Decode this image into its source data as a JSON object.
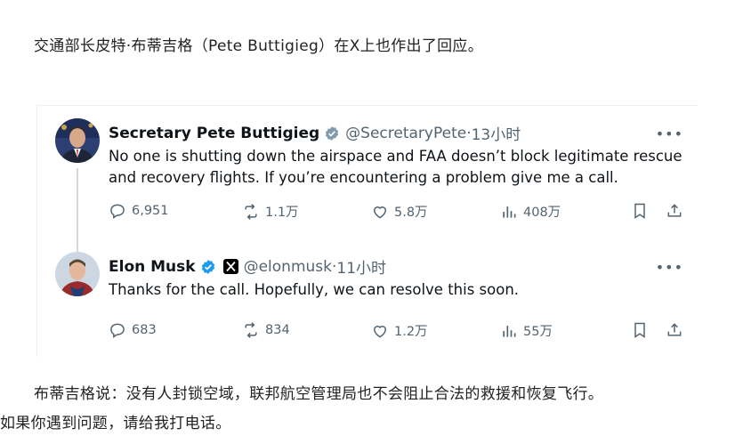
{
  "article": {
    "intro": "交通部长皮特·布蒂吉格（Pete Buttigieg）在X上也作出了回应。",
    "para2": "布蒂吉格说：没有人封锁空域，联邦航空管理局也不会阻止合法的救援和恢复飞行。",
    "para3": "如果你遇到问题，请给我打电话。"
  },
  "tweets": [
    {
      "name": "Secretary Pete Buttigieg",
      "badge": "verified-gray",
      "handle": "@SecretaryPete",
      "time": "13小时",
      "text": "No one is shutting down the airspace and FAA doesn’t block legitimate rescue and recovery flights. If you’re encountering a problem give me a call.",
      "replies": "6,951",
      "retweets": "1.1万",
      "likes": "5.8万",
      "views": "408万"
    },
    {
      "name": "Elon Musk",
      "badge": "verified-blue",
      "affiliate": "x-logo",
      "handle": "@elonmusk",
      "time": "11小时",
      "text": "Thanks for the call. Hopefully, we can resolve this soon.",
      "replies": "683",
      "retweets": "834",
      "likes": "1.2万",
      "views": "55万"
    }
  ],
  "ui": {
    "separator": " · ",
    "more": "•••"
  },
  "colors": {
    "text": "#0f1419",
    "muted": "#536471",
    "verified_blue": "#1d9bf0",
    "verified_gray": "#829aab"
  }
}
